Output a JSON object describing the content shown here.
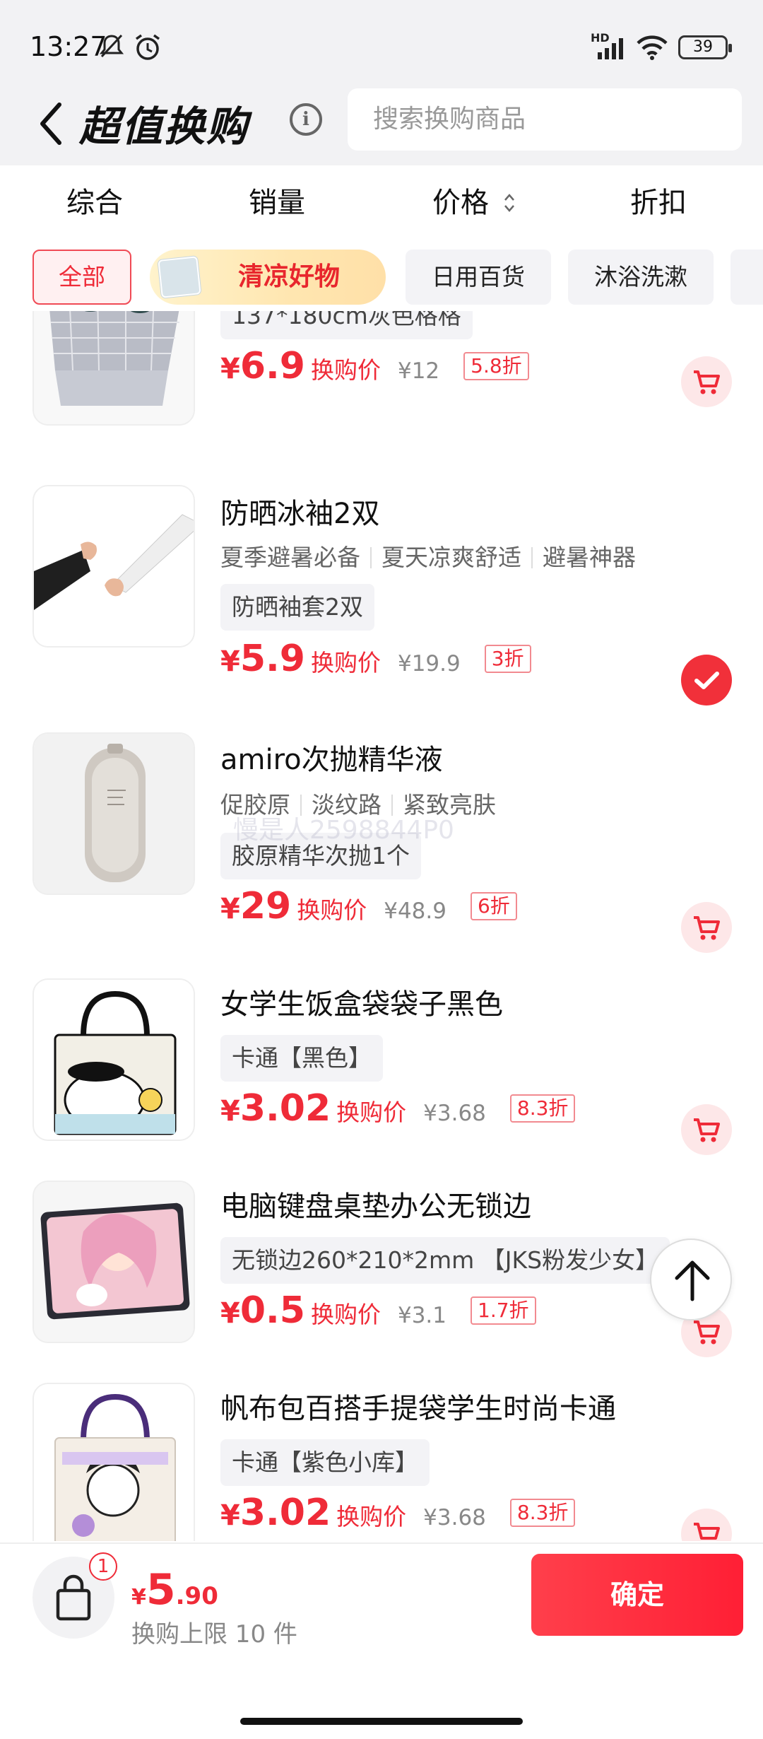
{
  "status_bar": {
    "time": "13:27",
    "battery": "39",
    "network": "HD"
  },
  "header": {
    "title": "超值换购",
    "info_icon": "i",
    "search_placeholder": "搜索换购商品"
  },
  "sort_tabs": [
    {
      "label": "综合"
    },
    {
      "label": "销量"
    },
    {
      "label": "价格"
    },
    {
      "label": "折扣"
    }
  ],
  "categories": [
    {
      "label": "全部",
      "active": true
    },
    {
      "label": "清凉好物",
      "promo": true
    },
    {
      "label": "日用百货"
    },
    {
      "label": "沐浴洗漱"
    }
  ],
  "products": [
    {
      "name": "",
      "tags": [],
      "spec": "137*180cm灰色格格",
      "price": "6.9",
      "price_label": "换购价",
      "original": "¥12",
      "discount": "5.8折",
      "selected": false
    },
    {
      "name": "防晒冰袖2双",
      "tags": [
        "夏季避暑必备",
        "夏天凉爽舒适",
        "避暑神器"
      ],
      "spec": "防晒袖套2双",
      "price": "5.9",
      "price_label": "换购价",
      "original": "¥19.9",
      "discount": "3折",
      "selected": true
    },
    {
      "name": "amiro次抛精华液",
      "tags": [
        "促胶原",
        "淡纹路",
        "紧致亮肤"
      ],
      "spec": "胶原精华次抛1个",
      "price": "29",
      "price_label": "换购价",
      "original": "¥48.9",
      "discount": "6折",
      "selected": false
    },
    {
      "name": "女学生饭盒袋袋子黑色",
      "tags": [],
      "spec": "卡通【黑色】",
      "price": "3.02",
      "price_label": "换购价",
      "original": "¥3.68",
      "discount": "8.3折",
      "selected": false
    },
    {
      "name": "电脑键盘桌垫办公无锁边",
      "tags": [],
      "spec": "无锁边260*210*2mm 【JKS粉发少女】",
      "price": "0.5",
      "price_label": "换购价",
      "original": "¥3.1",
      "discount": "1.7折",
      "selected": false
    },
    {
      "name": "帆布包百搭手提袋学生时尚卡通",
      "tags": [],
      "spec": "卡通【紫色小库】",
      "price": "3.02",
      "price_label": "换购价",
      "original": "¥3.68",
      "discount": "8.3折",
      "selected": false
    }
  ],
  "watermark": "慢是人2598844P0",
  "footer": {
    "badge": "1",
    "yen": "¥",
    "total_int": "5",
    "total_dec": ".90",
    "limit": "换购上限 10 件",
    "confirm": "确定"
  },
  "colors": {
    "accent": "#ef2b38",
    "header_bg": "#f2f2f4"
  }
}
